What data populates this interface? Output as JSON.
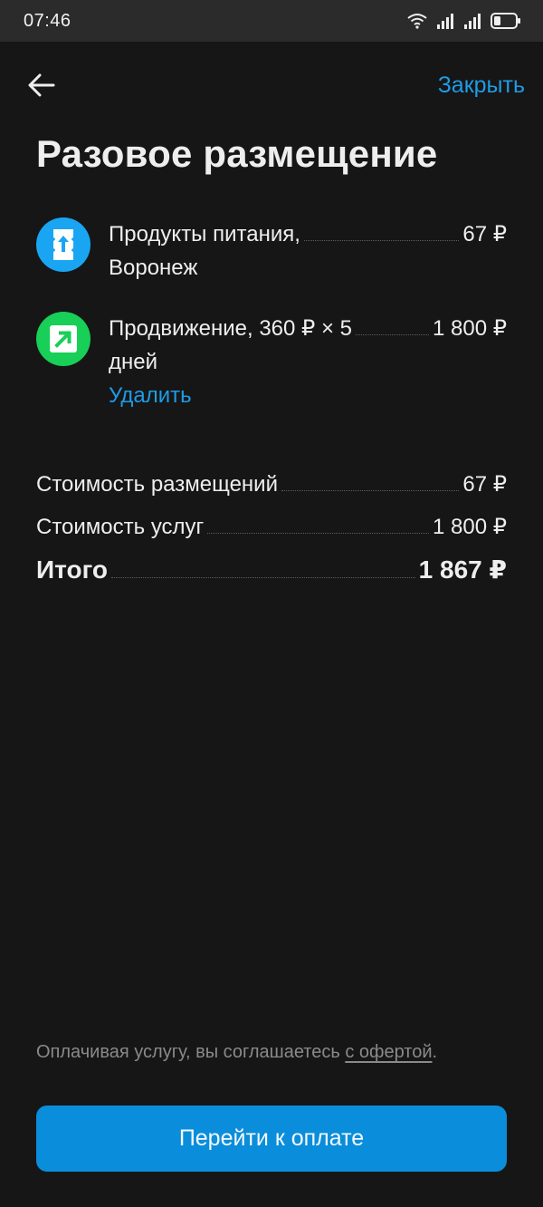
{
  "status": {
    "time": "07:46"
  },
  "header": {
    "close_label": "Закрыть",
    "title": "Разовое размещение"
  },
  "items": [
    {
      "line1": "Продукты питания,",
      "line2": "Воронеж",
      "price": "67 ₽",
      "icon": "listing-upload-icon",
      "icon_color": "#1aa5f2"
    },
    {
      "line1": "Продвижение, 360 ₽ × 5",
      "line2": "дней",
      "price": "1 800 ₽",
      "icon": "promotion-arrow-icon",
      "icon_color": "#18cf58",
      "remove_label": "Удалить"
    }
  ],
  "summary": {
    "placements_label": "Стоимость размещений",
    "placements_value": "67 ₽",
    "services_label": "Стоимость услуг",
    "services_value": "1 800 ₽",
    "total_label": "Итого",
    "total_value": "1 867 ₽"
  },
  "footer": {
    "agreement_prefix": "Оплачивая услугу, вы соглашаетесь ",
    "offer_link": "с офертой",
    "agreement_suffix": ".",
    "pay_button": "Перейти к оплате"
  },
  "colors": {
    "accent": "#0a8edb",
    "link": "#1e9ce6",
    "background": "#161616"
  }
}
